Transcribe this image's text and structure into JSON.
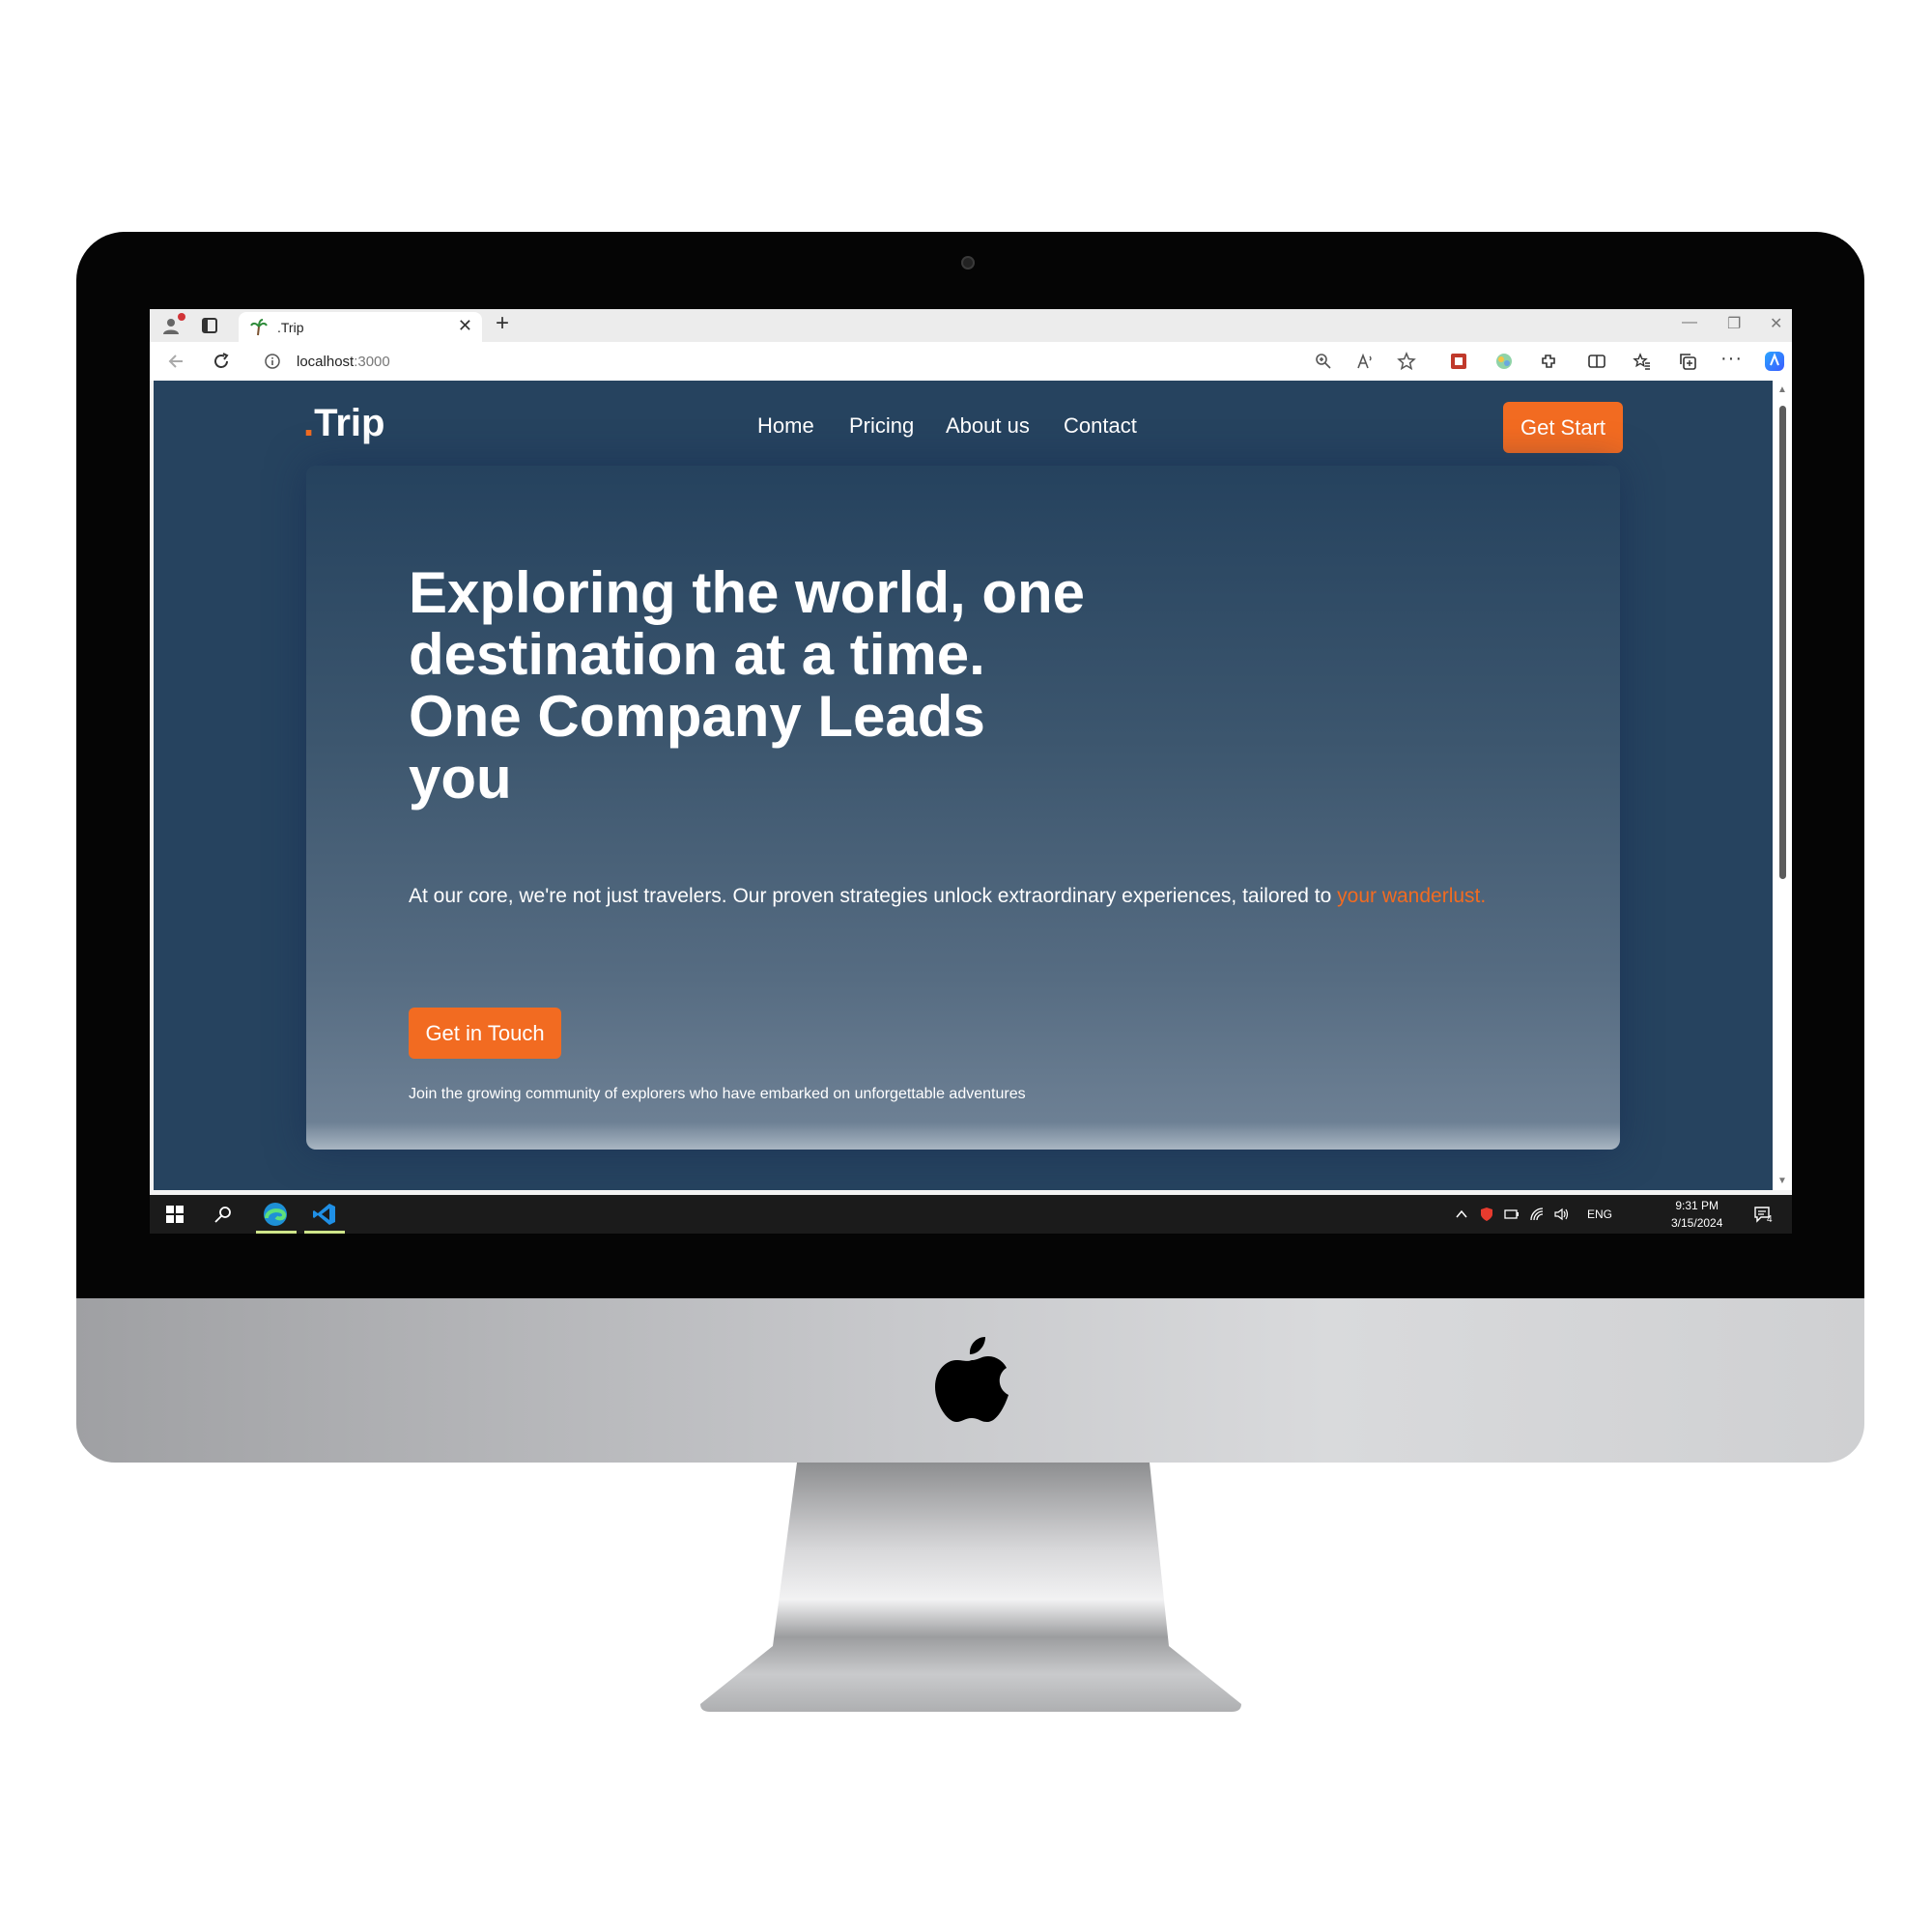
{
  "browser": {
    "tab_title": ".Trip",
    "tab_close": "✕",
    "new_tab": "+",
    "url_host": "localhost",
    "url_port": ":3000",
    "more_label": "···"
  },
  "site": {
    "logo_dot": ".",
    "logo_text": "Trip",
    "nav": [
      "Home",
      "Pricing",
      "About us",
      "Contact"
    ],
    "cta_label": "Get Start"
  },
  "hero": {
    "title": "Exploring the world, one\ndestination at a time.\nOne Company Leads\nyou",
    "text_main": "At our core, we're not just travelers. Our proven strategies unlock extraordinary experiences, tailored to ",
    "text_accent": "your wanderlust.",
    "button_label": "Get in Touch",
    "community_text": "Join the growing community of explorers who have embarked on unforgettable adventures"
  },
  "taskbar": {
    "language": "ENG",
    "time": "9:31 PM",
    "date": "3/15/2024",
    "notification_count": "4"
  },
  "colors": {
    "accent": "#f26b21",
    "page_bg": "#26435f",
    "taskbar_bg": "#1b1b1b"
  }
}
